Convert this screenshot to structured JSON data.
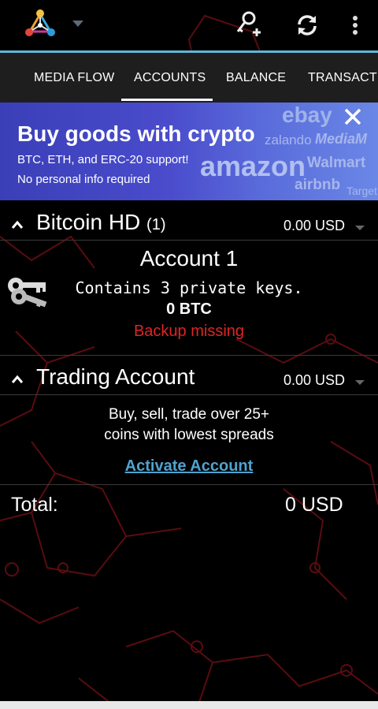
{
  "colors": {
    "accent": "#5fb8d6",
    "tab_bar_bg": "#1e1e1e",
    "banner_bg": "#4a4ccc",
    "warning": "#e02424",
    "link": "#4fa3cf",
    "bg_pattern": "#5a0c10"
  },
  "topbar": {
    "logo_icon": "mycelium-hex-logo-icon",
    "dropdown_icon": "caret-down-icon",
    "actions": [
      {
        "name": "add-key-icon"
      },
      {
        "name": "refresh-icon"
      },
      {
        "name": "more-vert-icon"
      }
    ]
  },
  "tabs": [
    {
      "label": "MEDIA FLOW",
      "selected": false
    },
    {
      "label": "ACCOUNTS",
      "selected": true
    },
    {
      "label": "BALANCE",
      "selected": false
    },
    {
      "label": "TRANSACTIONS",
      "selected": false
    }
  ],
  "banner": {
    "title": "Buy goods with crypto",
    "line1": "BTC, ETH, and ERC-20 support!",
    "line2": "No personal info required",
    "brands": [
      "ebay",
      "zalando",
      "MediaM",
      "amazon",
      "Walmart",
      "airbnb",
      "Target"
    ],
    "close_icon": "close-icon"
  },
  "bitcoin_hd": {
    "title": "Bitcoin HD",
    "count": "(1)",
    "amount": "0.00 USD",
    "account": {
      "name": "Account 1",
      "keys_text": "Contains 3 private keys.",
      "balance": "0 BTC",
      "warning": "Backup missing",
      "icon": "keys-icon"
    }
  },
  "trading": {
    "title": "Trading Account",
    "amount": "0.00 USD",
    "line1": "Buy, sell, trade over 25+",
    "line2": "coins with lowest spreads",
    "link": "Activate Account"
  },
  "total": {
    "label": "Total:",
    "value": "0 USD"
  }
}
